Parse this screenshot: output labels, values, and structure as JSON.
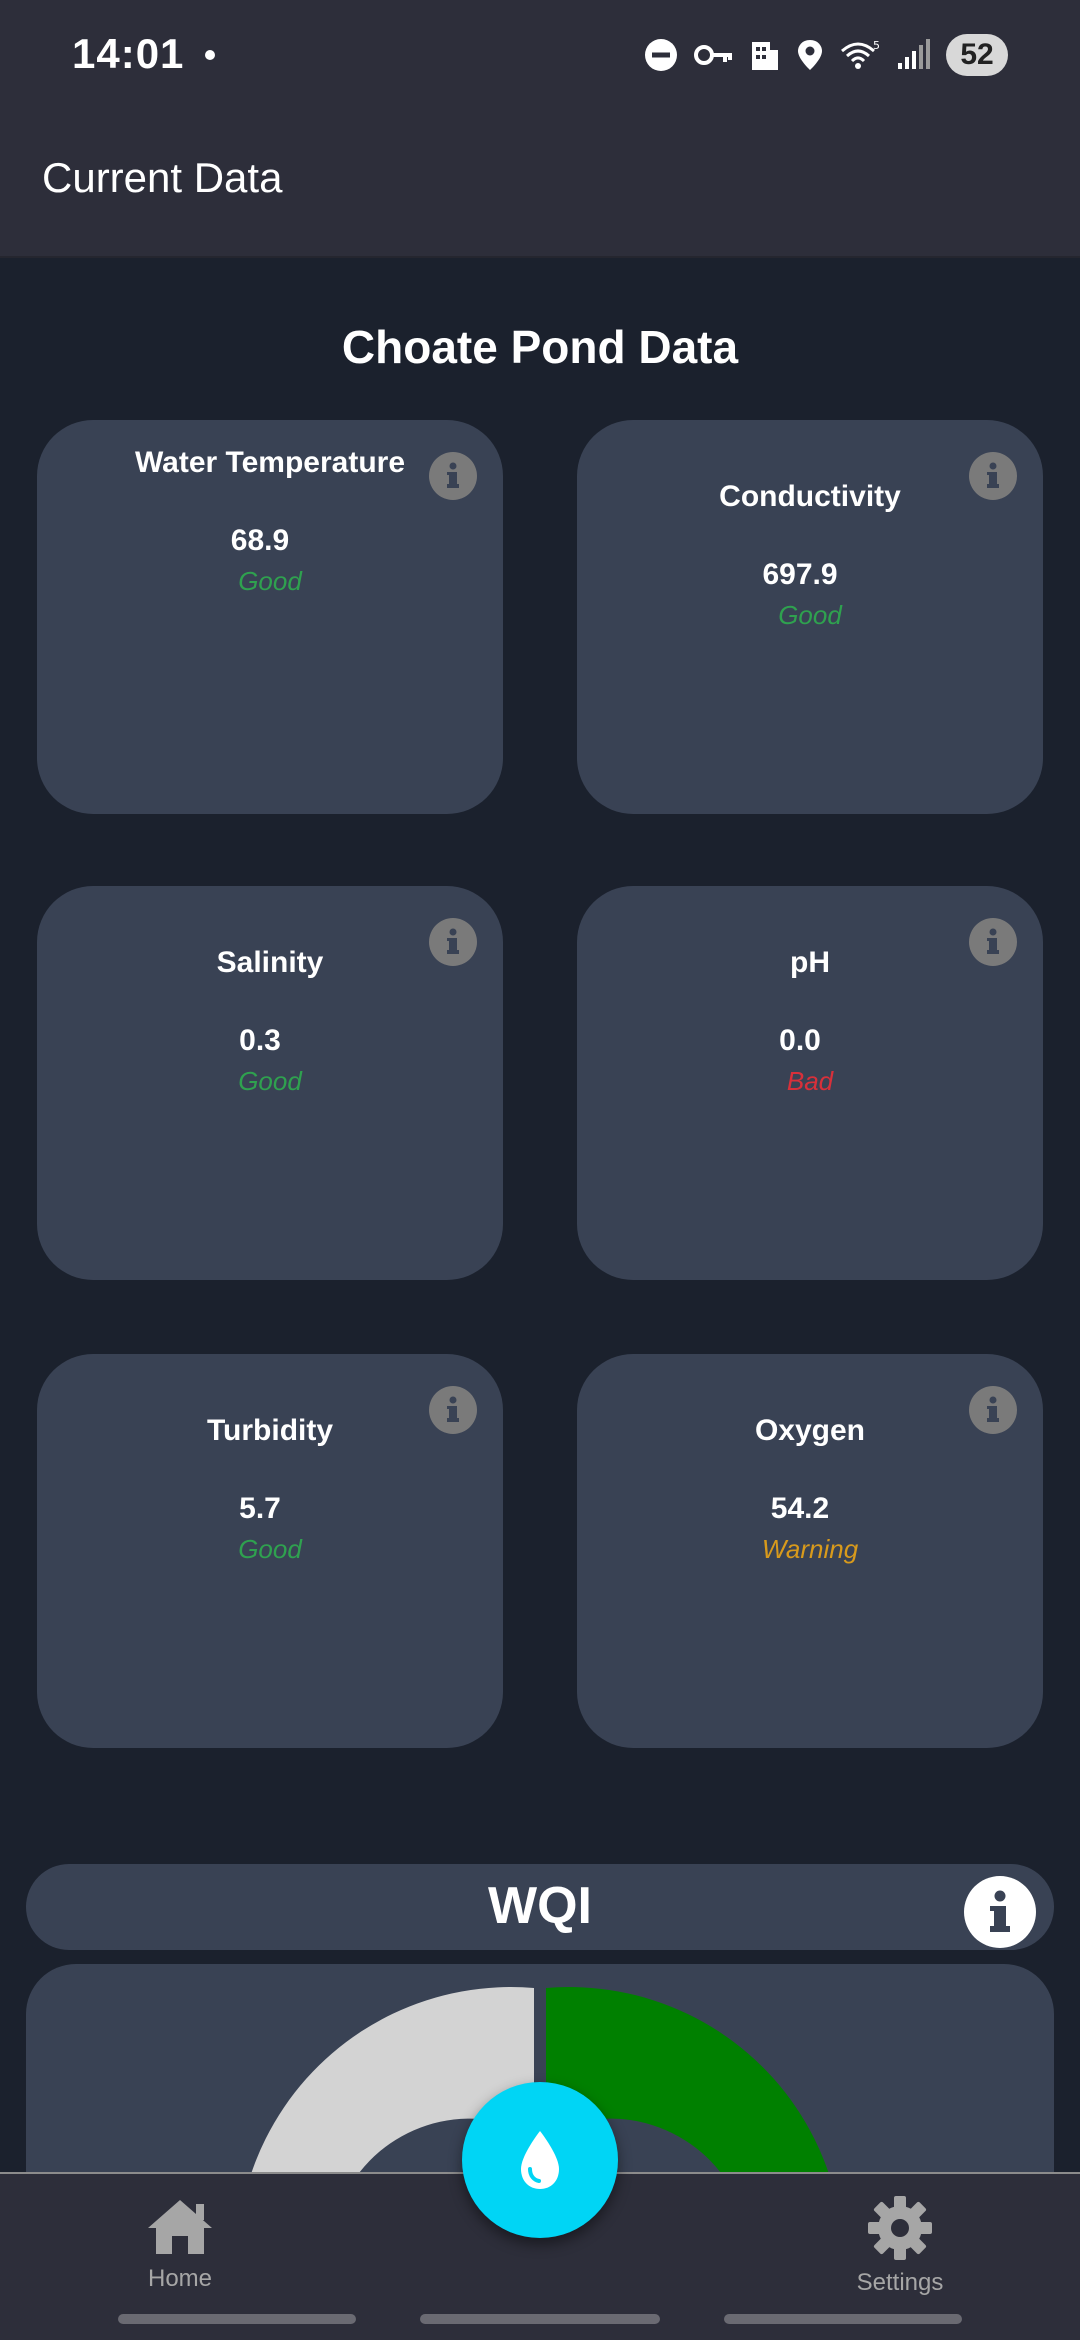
{
  "status_bar": {
    "time": "14:01",
    "battery": "52",
    "icons": [
      "do-not-disturb-icon",
      "vpn-key-icon",
      "work-profile-icon",
      "location-icon",
      "wifi-icon",
      "signal-icon"
    ]
  },
  "app_bar": {
    "title": "Current Data"
  },
  "page": {
    "title": "Choate Pond Data"
  },
  "cards": [
    {
      "title": "Water Temperature",
      "value": "68.9",
      "status": "Good"
    },
    {
      "title": "Conductivity",
      "value": "697.9",
      "status": "Good"
    },
    {
      "title": "Salinity",
      "value": "0.3",
      "status": "Good"
    },
    {
      "title": "pH",
      "value": "0.0",
      "status": "Bad"
    },
    {
      "title": "Turbidity",
      "value": "5.7",
      "status": "Good"
    },
    {
      "title": "Oxygen",
      "value": "54.2",
      "status": "Warning"
    }
  ],
  "wqi": {
    "title": "WQI"
  },
  "bottom_nav": {
    "home": "Home",
    "settings": "Settings"
  },
  "colors": {
    "good": "#2fa14f",
    "bad": "#d8303a",
    "warning": "#d89a1c",
    "fab": "#00d5f5",
    "gauge_fill": "#008000",
    "gauge_track": "#d3d3d3"
  }
}
